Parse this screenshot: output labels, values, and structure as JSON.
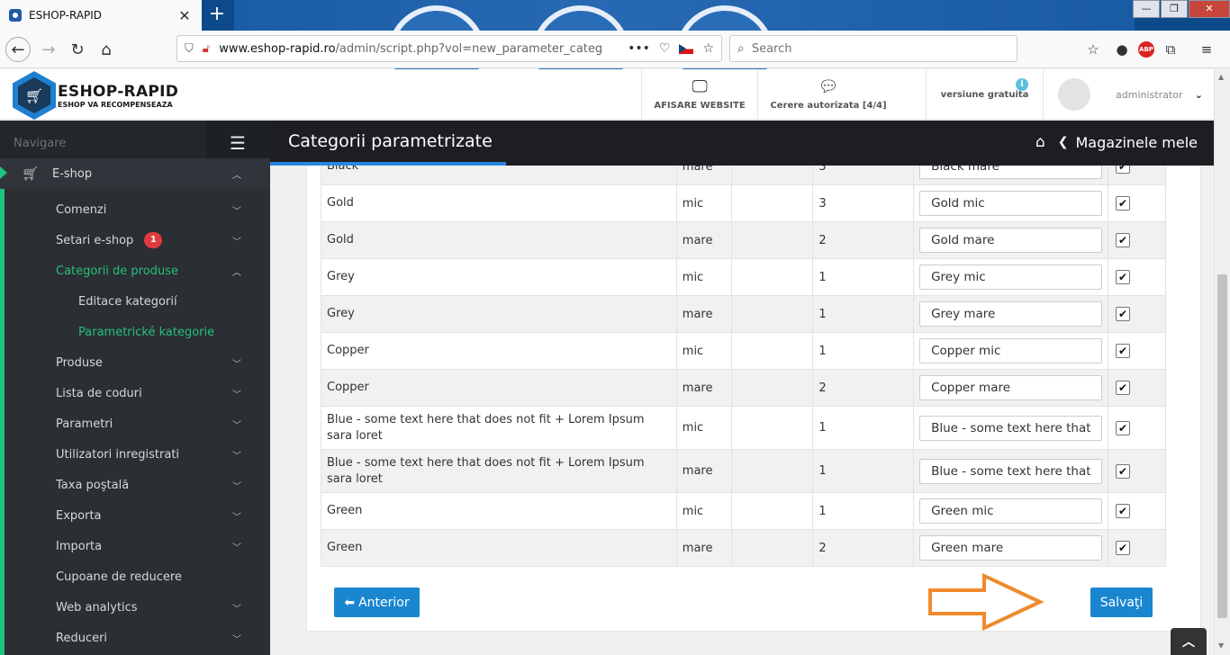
{
  "browser": {
    "tab_title": "ESHOP-RAPID",
    "tab_close": "✕",
    "new_tab": "+",
    "url_host": "www.eshop-rapid.ro",
    "url_path": "/admin/script.php?vol=new_parameter_categ",
    "search_placeholder": "Search",
    "more_actions": "•••"
  },
  "header": {
    "logo_name": "ESHOP-RAPID",
    "logo_slogan": "ESHOP VA RECOMPENSEAZA",
    "website_label": "AFISARE WEBSITE",
    "requests_label": "Cerere autorizata [4/4]",
    "version_label": "versiune gratuita",
    "version_info": "i",
    "username": "administrator"
  },
  "sidebar": {
    "nav_label": "Navigare",
    "main_item": "E-shop",
    "items": [
      {
        "label": "Comenzi",
        "chev": "down"
      },
      {
        "label": "Setari e-shop",
        "chev": "down",
        "badge": "1"
      },
      {
        "label": "Categorii de produse",
        "chev": "up",
        "active": true
      },
      {
        "label": "Editace kategorií",
        "sub": true
      },
      {
        "label": "Parametrické kategorie",
        "sub": true,
        "active": true
      },
      {
        "label": "Produse",
        "chev": "down"
      },
      {
        "label": "Lista de coduri",
        "chev": "down"
      },
      {
        "label": "Parametri",
        "chev": "down"
      },
      {
        "label": "Utilizatori inregistrati",
        "chev": "down"
      },
      {
        "label": "Taxa poştală",
        "chev": "down"
      },
      {
        "label": "Exporta",
        "chev": "down"
      },
      {
        "label": "Importa",
        "chev": "down"
      },
      {
        "label": "Cupoane de reducere"
      },
      {
        "label": "Web analytics",
        "chev": "down"
      },
      {
        "label": "Reduceri",
        "chev": "down"
      }
    ]
  },
  "page": {
    "title": "Categorii parametrizate",
    "breadcrumb": "Magazinele mele"
  },
  "table": {
    "rows": [
      {
        "name": "Black",
        "size": "mare",
        "qty": "3",
        "value": "Black mare",
        "checked": true
      },
      {
        "name": "Gold",
        "size": "mic",
        "qty": "3",
        "value": "Gold mic",
        "checked": true
      },
      {
        "name": "Gold",
        "size": "mare",
        "qty": "2",
        "value": "Gold mare",
        "checked": true
      },
      {
        "name": "Grey",
        "size": "mic",
        "qty": "1",
        "value": "Grey mic",
        "checked": true
      },
      {
        "name": "Grey",
        "size": "mare",
        "qty": "1",
        "value": "Grey mare",
        "checked": true
      },
      {
        "name": "Copper",
        "size": "mic",
        "qty": "1",
        "value": "Copper mic",
        "checked": true
      },
      {
        "name": "Copper",
        "size": "mare",
        "qty": "2",
        "value": "Copper mare",
        "checked": true
      },
      {
        "name": "Blue - some text here that does not fit + Lorem Ipsum sara loret",
        "size": "mic",
        "qty": "1",
        "value": "Blue - some text here that does not fit + Lorem Ipsum sara loret mic",
        "checked": true
      },
      {
        "name": "Blue - some text here that does not fit + Lorem Ipsum sara loret",
        "size": "mare",
        "qty": "1",
        "value": "Blue - some text here that does not fit + Lorem Ipsum sara loret mare",
        "checked": true
      },
      {
        "name": "Green",
        "size": "mic",
        "qty": "1",
        "value": "Green mic",
        "checked": true
      },
      {
        "name": "Green",
        "size": "mare",
        "qty": "2",
        "value": "Green mare",
        "checked": true
      }
    ]
  },
  "buttons": {
    "prev": "Anterior",
    "save": "Salvaţi"
  },
  "colors": {
    "accent": "#1a86d0",
    "sidebar_active": "#24c07c",
    "arrow": "#f08a2c"
  }
}
